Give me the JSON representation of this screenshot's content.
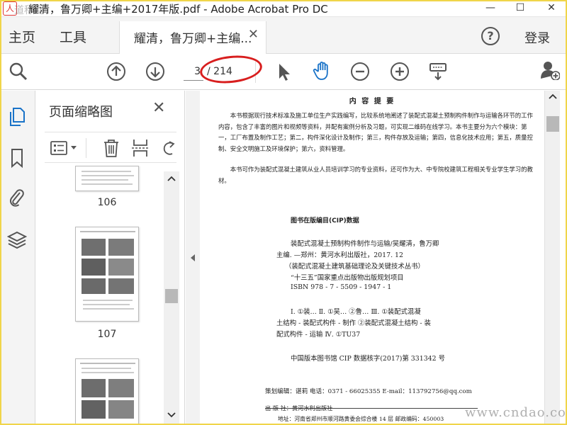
{
  "window": {
    "title": "耀清，鲁万卿+主编+2017年版.pdf - Adobe Acrobat Pro DC",
    "watermark_top": "道称网",
    "minimize_label": "—",
    "maximize_label": "☐",
    "close_label": "✕"
  },
  "menu": {
    "home": "主页",
    "tools": "工具",
    "doc_tab": "耀清，鲁万卿+主编...",
    "doc_tab_close": "✕",
    "help": "?",
    "login": "登录"
  },
  "toolbar": {
    "current_page": "3",
    "total_pages": "/ 214"
  },
  "thumbnail_panel": {
    "title": "页面缩略图",
    "close": "✕",
    "thumbnails": [
      {
        "label": "106"
      },
      {
        "label": "107"
      }
    ]
  },
  "document": {
    "heading": "内 容 提 要",
    "paragraph1": "本书根据现行技术标准及施工单位生产实践编写，比较系统地阐述了装配式混凝土预制构件制作与运输各环节的工作内容，包含了丰富的图片和视频等资料，并配有案例分析及习题，可实现二维码在线学习。本书主要分为六个模块：第一，工厂布置及制作工艺；第二，构件深化设计及制作；第三，构件存放及运输；第四，信息化技术应用；第五，质量控制、安全文明施工及环境保护；第六，资料管理。",
    "paragraph2": "本书可作为装配式混凝土建筑从业人员培训学习的专业资料，还可作为大、中专院校建筑工程相关专业学生学习的教材。",
    "cip_title": "图书在版编目(CIP)数据",
    "cip_lines": [
      "装配式混凝土预制构件制作与运输/吴耀清，鲁万卿",
      "主编. —郑州：黄河水利出版社，2017. 12",
      "（装配式混凝土建筑基础理论及关键技术丛书）",
      "“十三五”国家重点出版物出版规划项目",
      "ISBN 978 - 7 - 5509 - 1947 - 1"
    ],
    "class_lines": [
      "Ⅰ. ①装…   Ⅱ. ①吴… ②鲁…   Ⅲ. ①装配式混凝",
      "土结构 - 装配式构件 - 制作  ②装配式混凝土结构 - 装",
      "配式构件 - 运输   Ⅳ. ①TU37"
    ],
    "cip_number": "中国版本图书馆 CIP 数据核字(2017)第 331342 号",
    "editor_line": "策划编辑：谌莉   电话：0371 - 66025355   E-mail：113792756@qq.com",
    "publisher_line": "出  版  社：黄河水利出版社",
    "address_line": "地址：河南省郑州市顺河路黄委会综合楼 14 层   邮政编码：450003"
  },
  "overlay": {
    "watermark_bottom": "www.cndao.com"
  },
  "colors": {
    "annotation": "#d81e1e",
    "frame": "#f0d54a",
    "hand_tool": "#1a73c8"
  }
}
